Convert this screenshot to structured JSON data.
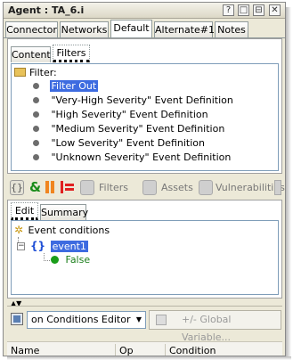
{
  "window": {
    "title": "Agent : TA_6.i",
    "buttons": [
      "?",
      "□",
      "⊟",
      "✕"
    ]
  },
  "outer_tabs": [
    {
      "label": "Connector",
      "active": false
    },
    {
      "label": "Networks",
      "active": false
    },
    {
      "label": "Default",
      "active": true
    },
    {
      "label": "Alternate#1",
      "active": false
    },
    {
      "label": "Notes",
      "active": false
    }
  ],
  "inner_tabs": [
    {
      "label": "Content",
      "active": false
    },
    {
      "label": "Filters",
      "active": true
    }
  ],
  "filter_tree": {
    "root_label": "Filter:",
    "items": [
      {
        "label": "Filter Out",
        "selected": true
      },
      {
        "label": "\"Very-High Severity\" Event Definition",
        "selected": false
      },
      {
        "label": "\"High Severity\" Event Definition",
        "selected": false
      },
      {
        "label": "\"Medium Severity\" Event Definition",
        "selected": false
      },
      {
        "label": "\"Low Severity\" Event Definition",
        "selected": false
      },
      {
        "label": "\"Unknown Severity\" Event Definition",
        "selected": false
      }
    ]
  },
  "toolbar": {
    "filters_label": "Filters",
    "assets_label": "Assets",
    "vulnerabilities_label": "Vulnerabilities"
  },
  "lower_tabs": [
    {
      "label": "Edit",
      "active": true
    },
    {
      "label": "Summary",
      "active": false
    }
  ],
  "conditions": {
    "root_label": "Event conditions",
    "node_label": "event1",
    "value_label": "False"
  },
  "editor": {
    "dropdown_value": "on Conditions Editor",
    "global_variable_button": "+/- Global Variable..."
  },
  "table": {
    "columns": [
      "Name",
      "Op",
      "Condition"
    ]
  },
  "colors": {
    "selection": "#3d6be0",
    "green_dot": "#1a9d1a",
    "blue_brace": "#1f4fd6"
  }
}
